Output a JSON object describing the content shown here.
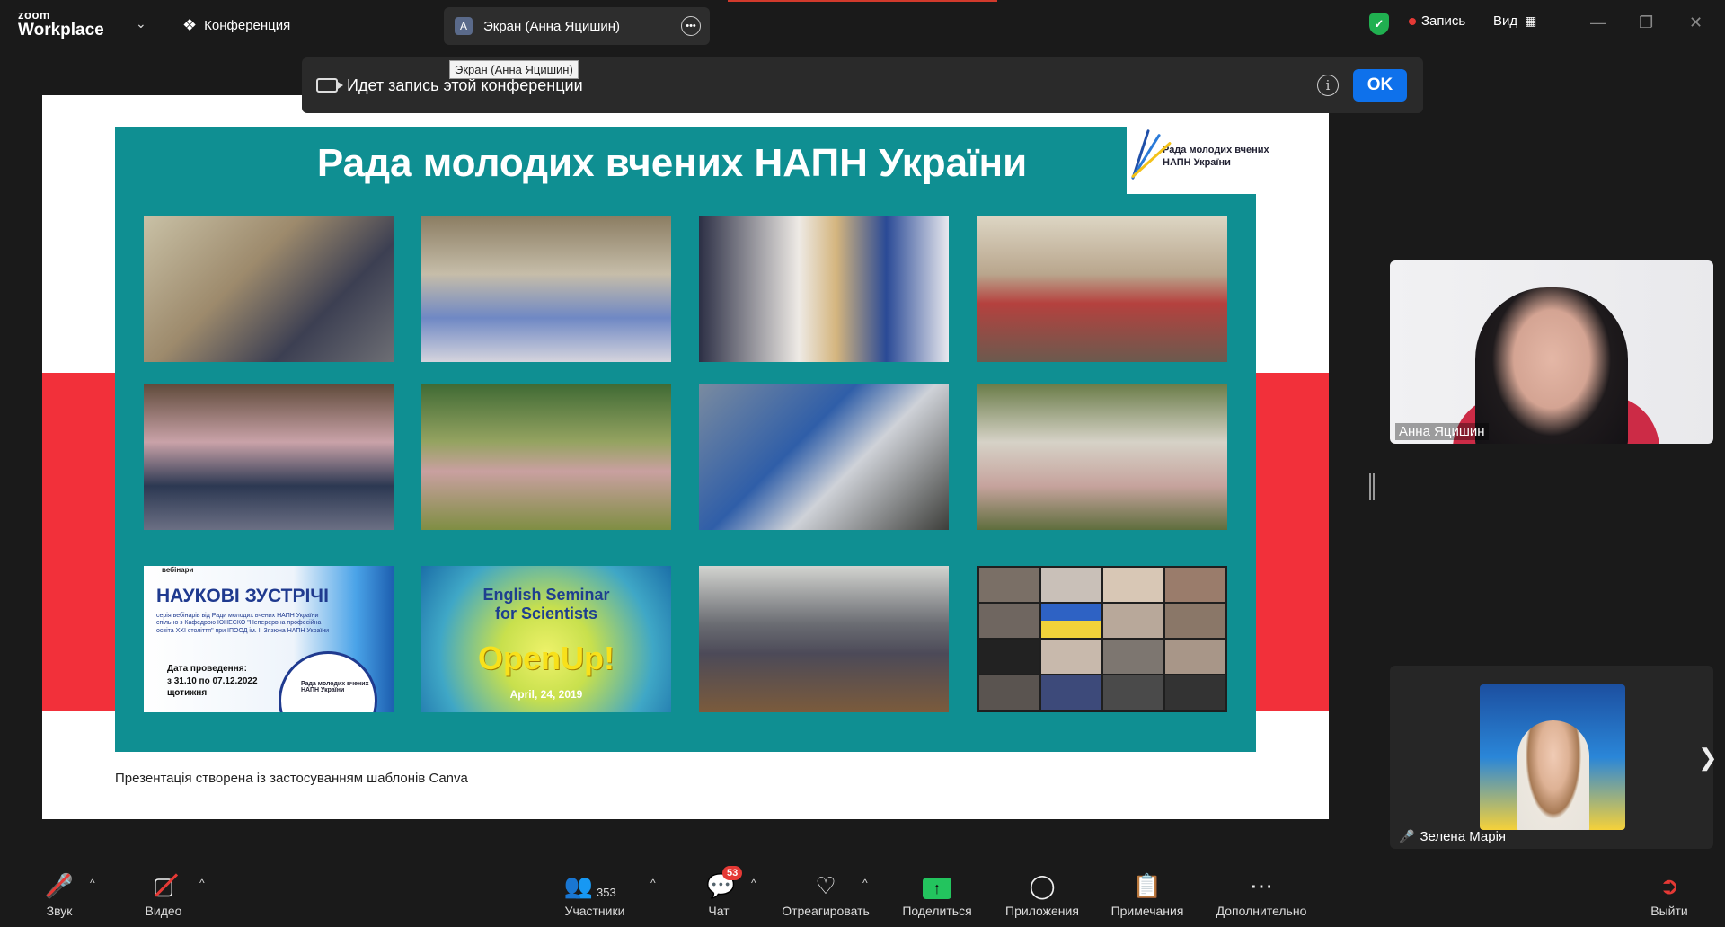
{
  "app": {
    "logo_small": "zoom",
    "logo_big": "Workplace",
    "conference_label": "Конференция",
    "screen_share_label": "Экран (Анна Яцишин)",
    "screen_share_avatar": "А",
    "tooltip": "Экран (Анна Яцишин)",
    "record_label": "Запись",
    "view_label": "Вид"
  },
  "banner": {
    "text": "Идет запись этой конференции",
    "ok_label": "OK",
    "info_glyph": "i"
  },
  "slide": {
    "title": "Рада молодих вчених НАПН України",
    "logo_text_1": "Рада молодих вчених",
    "logo_text_2": "НАПН України",
    "card_nz": {
      "top": "вебінари",
      "heading": "НАУКОВІ ЗУСТРІЧІ",
      "desc": "серія вебінарів від Ради молодих вчених НАПН України спільно з Кафедрою ЮНЕСКО \"Неперервна професійна освіта XXI століття\" при ІПООД ім. І. Зязюна НАПН України",
      "date_label": "Дата проведення:",
      "date_range": "з 31.10 по 07.12.2022",
      "frequency": "щотижня",
      "circle_text": "Рада молодих вчених НАПН України"
    },
    "card_en": {
      "line1": "English Seminar",
      "line2": "for Scientists",
      "brand": "OpenUp!",
      "date": "April, 24, 2019"
    },
    "footer": "Презентація створена  із застосуванням шаблонів  Canva"
  },
  "participants": {
    "video1_name": "Анна Яцишин",
    "video2_name": "Зелена Марія"
  },
  "toolbar": {
    "audio": "Звук",
    "video": "Видео",
    "participants": "Участники",
    "participants_count": "353",
    "chat": "Чат",
    "chat_badge": "53",
    "react": "Отреагировать",
    "share": "Поделиться",
    "apps": "Приложения",
    "notes": "Примечания",
    "more": "Дополнительно",
    "leave": "Выйти"
  },
  "colors": {
    "accent_blue": "#0e71eb",
    "share_green": "#23c45e",
    "slide_teal": "#0f8f92",
    "slide_red": "#f2303a",
    "badge_red": "#e53935"
  }
}
